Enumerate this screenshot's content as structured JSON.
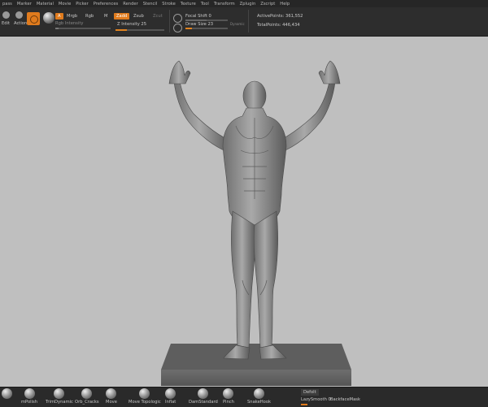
{
  "menu": [
    "pass",
    "Marker",
    "Material",
    "Movie",
    "Picker",
    "Preferences",
    "Render",
    "Stencil",
    "Stroke",
    "Texture",
    "Tool",
    "Transform",
    "Zplugin",
    "Zscript",
    "Help"
  ],
  "toolbar": {
    "edit_label": "Edit",
    "actions_label": "Actions",
    "a_button": "A",
    "mrgb": "Mrgb",
    "rgb": "Rgb",
    "m": "M",
    "rgb_intensity": "Rgb Intensity",
    "zadd": "Zadd",
    "zsub": "Zsub",
    "zcut": "Zcut",
    "z_intensity": "Z Intensity 25",
    "focal_shift": "Focal Shift 0",
    "draw_size": "Draw Size 23",
    "dynamic": "Dynamic",
    "active_points": "ActivePoints: 361,552",
    "total_points": "TotalPoints: 446,434",
    "z_intensity_value": 25
  },
  "bottom": {
    "brushes": [
      "",
      "mPolish",
      "TrimDynamic",
      "Orb_Cracks",
      "Move",
      "Move Topologic",
      "Inflat",
      "DamStandard",
      "Pinch",
      "SnakeHook"
    ],
    "depth_label": "Defolt",
    "lazy_smooth": "LazySmooth 0",
    "backface_mask": "BackfaceMask"
  },
  "colors": {
    "accent": "#e07b1d",
    "viewport": "#bfbfbf"
  }
}
